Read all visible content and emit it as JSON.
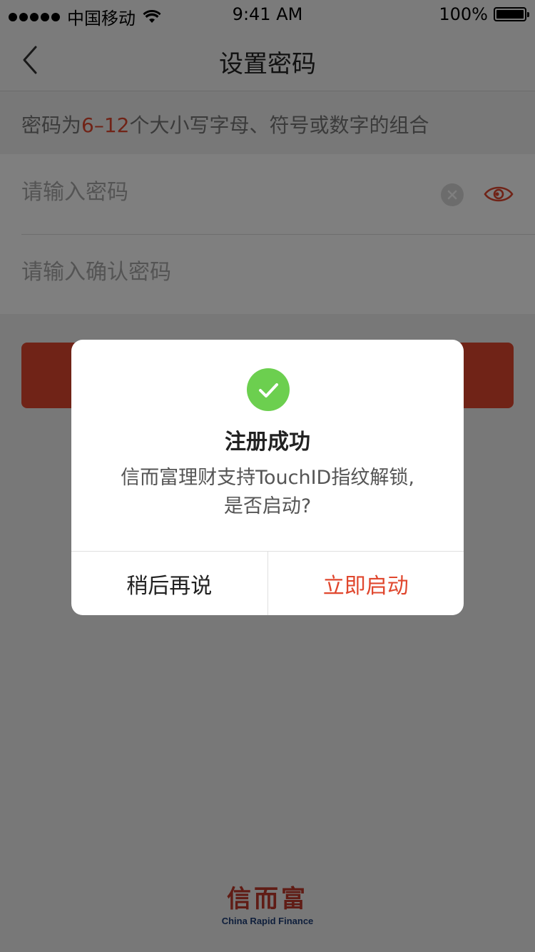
{
  "status_bar": {
    "carrier": "中国移动",
    "time": "9:41 AM",
    "battery": "100%"
  },
  "nav": {
    "title": "设置密码"
  },
  "hint": {
    "prefix": "密码为",
    "range": "6–12",
    "suffix": "个大小写字母、符号或数字的组合"
  },
  "form": {
    "password_placeholder": "请输入密码",
    "password_value": "",
    "confirm_placeholder": "请输入确认密码",
    "confirm_value": ""
  },
  "dialog": {
    "title": "注册成功",
    "message_line1": "信而富理财支持TouchID指纹解锁,",
    "message_line2": "是否启动?",
    "later_label": "稍后再说",
    "enable_label": "立即启动"
  },
  "footer": {
    "logo_cn": "信而富",
    "logo_en": "China Rapid Finance"
  },
  "icons": {
    "back": "chevron-left-icon",
    "clear": "clear-icon",
    "eye": "eye-icon",
    "success": "check-circle-icon",
    "wifi": "wifi-icon",
    "battery": "battery-icon"
  },
  "colors": {
    "accent": "#e0472e",
    "success": "#6ccf4f",
    "logo_red": "#c0392b",
    "logo_blue": "#1f3f78"
  }
}
